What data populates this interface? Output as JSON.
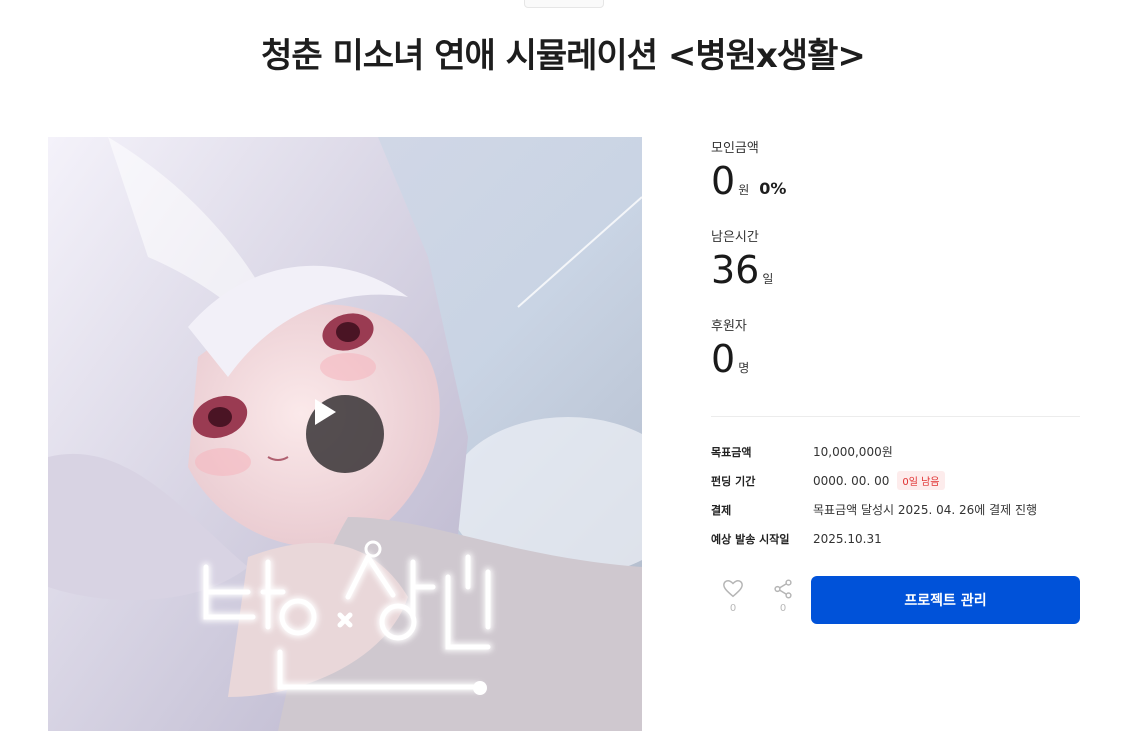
{
  "project": {
    "title": "청춘 미소녀 연애 시뮬레이션 <병원x생활>"
  },
  "cover": {
    "logo_text": "병원×생활",
    "play_icon": "play-icon"
  },
  "stats": {
    "raised_label": "모인금액",
    "raised_value": "0",
    "raised_unit": "원",
    "raised_percent": "0%",
    "remaining_label": "남은시간",
    "remaining_value": "36",
    "remaining_unit": "일",
    "backers_label": "후원자",
    "backers_value": "0",
    "backers_unit": "명"
  },
  "info": {
    "goal_label": "목표금액",
    "goal_value": "10,000,000원",
    "period_label": "펀딩 기간",
    "period_value": "0000. 00. 00",
    "period_badge": "0일 남음",
    "payment_label": "결제",
    "payment_value": "목표금액 달성시 2025. 04. 26에 결제 진행",
    "delivery_label": "예상 발송 시작일",
    "delivery_value": "2025.10.31"
  },
  "actions": {
    "like_icon": "heart-icon",
    "like_count": "0",
    "share_icon": "share-icon",
    "share_count": "0",
    "manage_label": "프로젝트 관리"
  },
  "colors": {
    "primary_button": "#0052d9",
    "badge_text": "#e03030",
    "badge_bg": "#fdecec"
  }
}
